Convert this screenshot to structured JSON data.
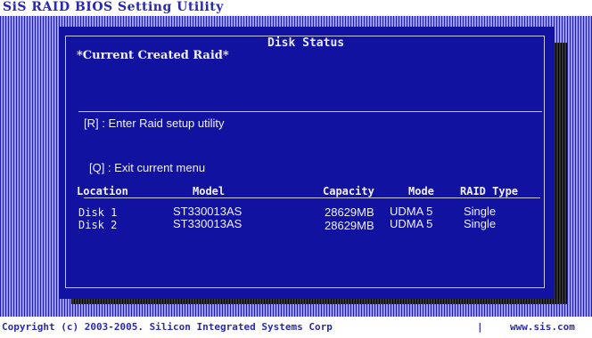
{
  "app_title": "SiS RAID BIOS Setting Utility",
  "window": {
    "title": "Disk Status",
    "current_raid_label": "*Current Created Raid*"
  },
  "menu": {
    "setup": "[R] : Enter Raid setup utility",
    "exit": "[Q] : Exit current menu"
  },
  "table": {
    "headers": [
      "Location",
      "Model",
      "Capacity",
      "Mode",
      "RAID Type"
    ],
    "rows": [
      [
        "Disk 1",
        "ST330013AS",
        "28629MB",
        "UDMA 5",
        "Single"
      ],
      [
        "Disk 2",
        "ST330013AS",
        "28629MB",
        "UDMA 5",
        "Single"
      ]
    ]
  },
  "footer": {
    "copyright": "Copyright (c) 2003-2005. Silicon Integrated Systems Corp",
    "divider": "|",
    "url": "www.sis.com"
  }
}
